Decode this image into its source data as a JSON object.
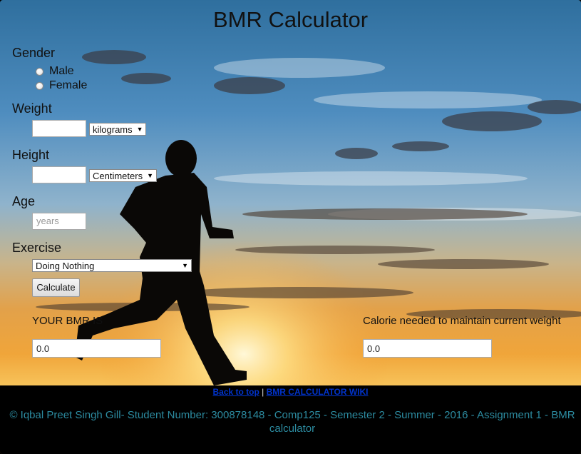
{
  "title": "BMR Calculator",
  "gender": {
    "label": "Gender",
    "options": [
      "Male",
      "Female"
    ]
  },
  "weight": {
    "label": "Weight",
    "value": "",
    "unit": "kilograms"
  },
  "height": {
    "label": "Height",
    "value": "",
    "unit": "Centimeters"
  },
  "age": {
    "label": "Age",
    "placeholder": "years"
  },
  "exercise": {
    "label": "Exercise",
    "selected": "Doing Nothing"
  },
  "calculate_label": "Calculate",
  "results": {
    "bmr_label": "YOUR BMR IS",
    "bmr_value": "0.0",
    "calorie_label": "Calorie needed to maintain current weight",
    "calorie_value": "0.0"
  },
  "footer": {
    "back_to_top": "Back to top",
    "separator": "|",
    "wiki": "BMR CALCULATOR WIKI",
    "copyright": "©  Iqbal Preet Singh Gill- Student Number: 300878148 - Comp125 - Semester 2 - Summer - 2016 - Assignment 1 - BMR calculator"
  },
  "colors": {
    "link": "#0033cc",
    "copyright": "#2c8ba0"
  }
}
